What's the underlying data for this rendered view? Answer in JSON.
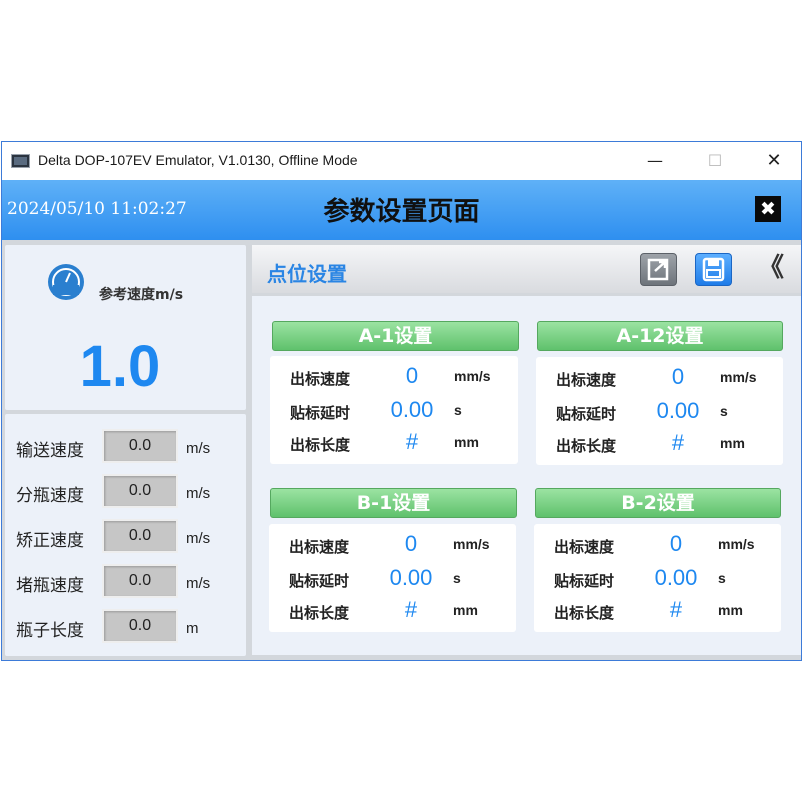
{
  "window": {
    "title": "Delta DOP-107EV Emulator, V1.0130, Offline Mode",
    "min_symbol": "—",
    "max_symbol": "☐",
    "close_symbol": "✕"
  },
  "header": {
    "datetime": "2024/05/10 11:02:27",
    "title": "参数设置页面",
    "close_symbol": "✖"
  },
  "speed_panel": {
    "label": "参考速度m/s",
    "value": "1.0",
    "icon": "gauge-icon"
  },
  "params": [
    {
      "label": "输送速度",
      "value": "0.0",
      "unit": "m/s"
    },
    {
      "label": "分瓶速度",
      "value": "0.0",
      "unit": "m/s"
    },
    {
      "label": "矫正速度",
      "value": "0.0",
      "unit": "m/s"
    },
    {
      "label": "堵瓶速度",
      "value": "0.0",
      "unit": "m/s"
    },
    {
      "label": "瓶子长度",
      "value": "0.0",
      "unit": "m"
    }
  ],
  "section": {
    "title": "点位设置",
    "back_symbol": "《",
    "exit_icon": "exit-icon",
    "save_icon": "save-icon"
  },
  "cards": [
    {
      "title": "A-1设置",
      "rows": [
        {
          "label": "出标速度",
          "value": "0",
          "unit": "mm/s"
        },
        {
          "label": "贴标延时",
          "value": "0.00",
          "unit": "s"
        },
        {
          "label": "出标长度",
          "value": "#",
          "unit": "mm"
        }
      ]
    },
    {
      "title": "A-12设置",
      "rows": [
        {
          "label": "出标速度",
          "value": "0",
          "unit": "mm/s"
        },
        {
          "label": "贴标延时",
          "value": "0.00",
          "unit": "s"
        },
        {
          "label": "出标长度",
          "value": "#",
          "unit": "mm"
        }
      ]
    },
    {
      "title": "B-1设置",
      "rows": [
        {
          "label": "出标速度",
          "value": "0",
          "unit": "mm/s"
        },
        {
          "label": "贴标延时",
          "value": "0.00",
          "unit": "s"
        },
        {
          "label": "出标长度",
          "value": "#",
          "unit": "mm"
        }
      ]
    },
    {
      "title": "B-2设置",
      "rows": [
        {
          "label": "出标速度",
          "value": "0",
          "unit": "mm/s"
        },
        {
          "label": "贴标延时",
          "value": "0.00",
          "unit": "s"
        },
        {
          "label": "出标长度",
          "value": "#",
          "unit": "mm"
        }
      ]
    }
  ],
  "colors": {
    "accent": "#2a85e4",
    "header_top": "#5fb1f7",
    "header_bottom": "#2e8ff0",
    "card_title": "#6fcb7b",
    "value_blue": "#1e88f0"
  }
}
